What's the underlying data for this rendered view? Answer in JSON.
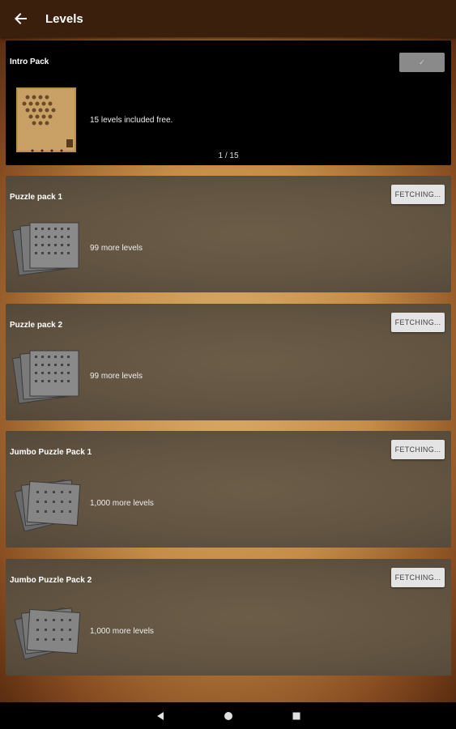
{
  "app_bar": {
    "title": "Levels",
    "back_icon": "arrow-back-icon"
  },
  "packs": [
    {
      "name": "Intro Pack",
      "description": "15 levels included free.",
      "button": "✓",
      "pager": "1 / 15"
    },
    {
      "name": "Puzzle pack 1",
      "description": "99 more levels",
      "button": "FETCHING..."
    },
    {
      "name": "Puzzle pack 2",
      "description": "99 more levels",
      "button": "FETCHING..."
    },
    {
      "name": "Jumbo Puzzle Pack 1",
      "description": "1,000 more levels",
      "button": "FETCHING..."
    },
    {
      "name": "Jumbo Puzzle Pack 2",
      "description": "1,000 more levels",
      "button": "FETCHING..."
    }
  ],
  "nav_bar": {
    "back": "triangle-back-icon",
    "home": "circle-home-icon",
    "recents": "square-recents-icon"
  },
  "colors": {
    "app_bar": "#3a1f0d",
    "card_bg": "#625441",
    "wood": "#c58d48",
    "button": "#e4e4e4"
  }
}
